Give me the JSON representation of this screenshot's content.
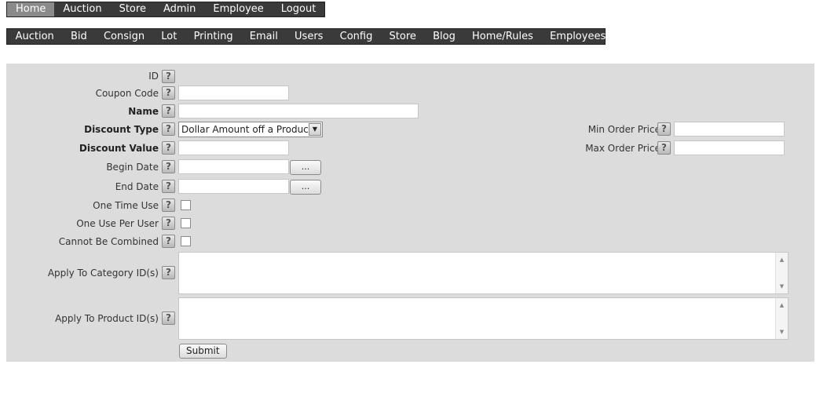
{
  "top_nav": [
    "Home",
    "Auction",
    "Store",
    "Admin",
    "Employee",
    "Logout"
  ],
  "sub_nav": [
    "Auction",
    "Bid",
    "Consign",
    "Lot",
    "Printing",
    "Email",
    "Users",
    "Config",
    "Store",
    "Blog",
    "Home/Rules",
    "Employees"
  ],
  "help_glyph": "?",
  "form": {
    "id_label": "ID",
    "coupon_code_label": "Coupon Code",
    "coupon_code_value": "",
    "name_label": "Name",
    "name_value": "",
    "discount_type_label": "Discount Type",
    "discount_type_selected": "Dollar Amount off a Product",
    "discount_value_label": "Discount Value",
    "discount_value_value": "",
    "begin_date_label": "Begin Date",
    "begin_date_value": "",
    "end_date_label": "End Date",
    "end_date_value": "",
    "date_button_label": "...",
    "one_time_use_label": "One Time Use",
    "one_use_per_user_label": "One Use Per User",
    "cannot_be_combined_label": "Cannot Be Combined",
    "apply_category_label": "Apply To Category ID(s)",
    "apply_product_label": "Apply To Product ID(s)",
    "min_order_price_label": "Min Order Price",
    "min_order_price_value": "",
    "max_order_price_label": "Max Order Price",
    "max_order_price_value": "",
    "submit_label": "Submit"
  },
  "colors": {
    "nav_bg": "#3a3a3a",
    "nav_active_bg": "#8a8a8a",
    "panel_bg": "#dcdcdc"
  }
}
